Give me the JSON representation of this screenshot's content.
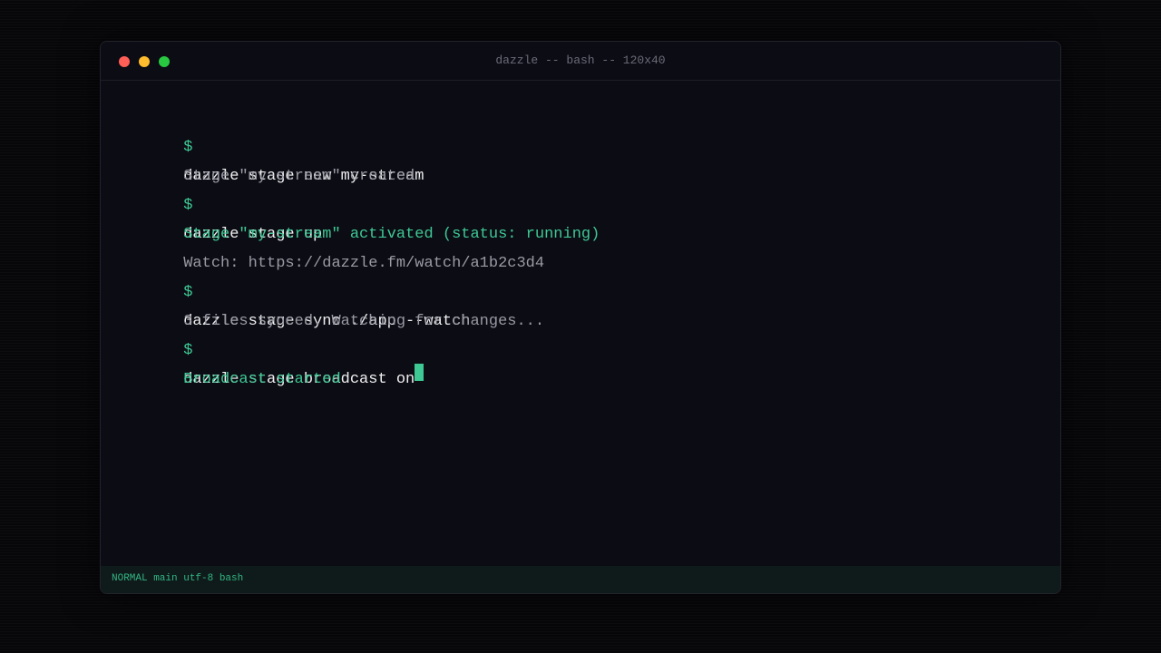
{
  "window": {
    "title": "dazzle -- bash -- 120x40",
    "buttons": [
      {
        "name": "close",
        "color": "#ff5f57"
      },
      {
        "name": "minimize",
        "color": "#febc2e"
      },
      {
        "name": "maximize",
        "color": "#28c840"
      }
    ]
  },
  "terminal": {
    "prompt": "$",
    "lines": [
      {
        "kind": "command",
        "text": "dazzle stage new my-stream"
      },
      {
        "kind": "output",
        "text": "Stage \"my-stream\" created."
      },
      {
        "kind": "command",
        "text": "dazzle stage up"
      },
      {
        "kind": "success",
        "text": "Stage \"my-stream\" activated (status: running)"
      },
      {
        "kind": "output",
        "text": "Watch: https://dazzle.fm/watch/a1b2c3d4"
      },
      {
        "kind": "command",
        "text": "dazzle stage sync ./app --watch"
      },
      {
        "kind": "output",
        "text": "3 files synced. Watching for changes..."
      },
      {
        "kind": "command",
        "text": "dazzle stage broadcast on",
        "cursor": true
      },
      {
        "kind": "success",
        "text": "Broadcast started"
      }
    ]
  },
  "statusbar": {
    "text": "NORMAL main utf-8 bash"
  },
  "colors": {
    "accent": "#3ec994",
    "command_text": "#f0f0f2",
    "output_text": "#9a9aa4",
    "background": "#0c0c14"
  }
}
